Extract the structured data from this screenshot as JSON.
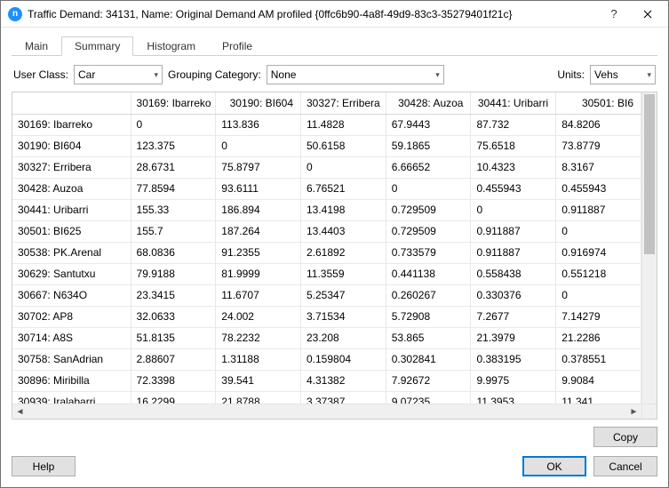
{
  "title": "Traffic Demand: 34131, Name: Original Demand AM profiled  {0ffc6b90-4a8f-49d9-83c3-35279401f21c}",
  "tabs": {
    "main": "Main",
    "summary": "Summary",
    "histogram": "Histogram",
    "profile": "Profile"
  },
  "filters": {
    "user_class_label": "User Class:",
    "user_class_value": "Car",
    "grouping_label": "Grouping Category:",
    "grouping_value": "None",
    "units_label": "Units:",
    "units_value": "Vehs"
  },
  "columns": [
    "",
    "30169: Ibarreko",
    "30190: BI604",
    "30327: Erribera",
    "30428: Auzoa",
    "30441: Uribarri",
    "30501: BI6"
  ],
  "rows": [
    [
      "30169: Ibarreko",
      "0",
      "113.836",
      "11.4828",
      "67.9443",
      "87.732",
      "84.8206"
    ],
    [
      "30190: BI604",
      "123.375",
      "0",
      "50.6158",
      "59.1865",
      "75.6518",
      "73.8779"
    ],
    [
      "30327: Erribera",
      "28.6731",
      "75.8797",
      "0",
      "6.66652",
      "10.4323",
      "8.3167"
    ],
    [
      "30428: Auzoa",
      "77.8594",
      "93.6111",
      "6.76521",
      "0",
      "0.455943",
      "0.455943"
    ],
    [
      "30441: Uribarri",
      "155.33",
      "186.894",
      "13.4198",
      "0.729509",
      "0",
      "0.911887"
    ],
    [
      "30501: BI625",
      "155.7",
      "187.264",
      "13.4403",
      "0.729509",
      "0.911887",
      "0"
    ],
    [
      "30538: PK.Arenal",
      "68.0836",
      "91.2355",
      "2.61892",
      "0.733579",
      "0.911887",
      "0.916974"
    ],
    [
      "30629: Santutxu",
      "79.9188",
      "81.9999",
      "11.3559",
      "0.441138",
      "0.558438",
      "0.551218"
    ],
    [
      "30667: N634O",
      "23.3415",
      "11.6707",
      "5.25347",
      "0.260267",
      "0.330376",
      "0"
    ],
    [
      "30702: AP8",
      "32.0633",
      "24.002",
      "3.71534",
      "5.72908",
      "7.2677",
      "7.14279"
    ],
    [
      "30714: A8S",
      "51.8135",
      "78.2232",
      "23.208",
      "53.865",
      "21.3979",
      "21.2286"
    ],
    [
      "30758: SanAdrian",
      "2.88607",
      "1.31188",
      "0.159804",
      "0.302841",
      "0.383195",
      "0.378551"
    ],
    [
      "30896: Miribilla",
      "72.3398",
      "39.541",
      "4.31382",
      "7.92672",
      "9.9975",
      "9.9084"
    ],
    [
      "30939: Iralabarri",
      "16.2299",
      "21.8788",
      "3.37387",
      "9.07235",
      "11.3953",
      "11.341"
    ]
  ],
  "buttons": {
    "copy": "Copy",
    "help": "Help",
    "ok": "OK",
    "cancel": "Cancel"
  }
}
